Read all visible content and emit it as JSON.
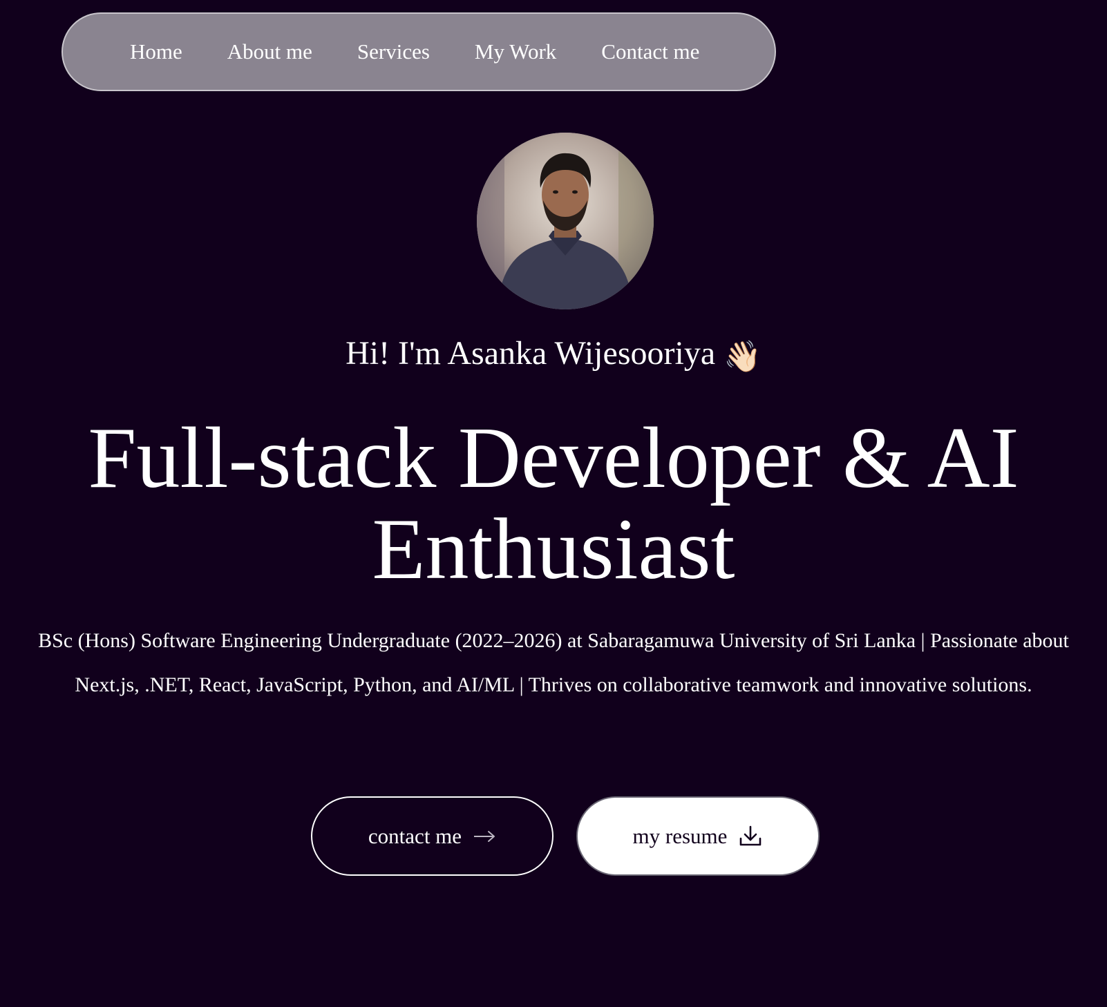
{
  "nav": {
    "items": [
      {
        "label": "Home"
      },
      {
        "label": "About me"
      },
      {
        "label": "Services"
      },
      {
        "label": "My Work"
      },
      {
        "label": "Contact me"
      }
    ]
  },
  "hero": {
    "avatar_icon": "profile-photo",
    "greeting": "Hi! I'm Asanka Wijesooriya",
    "wave_emoji": "👋🏻",
    "headline": "Full-stack Developer & AI Enthusiast",
    "description": "BSc (Hons) Software Engineering Undergraduate (2022–2026) at Sabaragamuwa University of Sri Lanka | Passionate about Next.js, .NET, React, JavaScript, Python, and AI/ML | Thrives on collaborative teamwork and innovative solutions."
  },
  "buttons": {
    "contact_label": "contact me",
    "contact_icon": "arrow-right-icon",
    "resume_label": "my resume",
    "resume_icon": "download-icon"
  },
  "colors": {
    "background": "#11001c",
    "nav_background": "#8a8490",
    "text": "#ffffff"
  }
}
